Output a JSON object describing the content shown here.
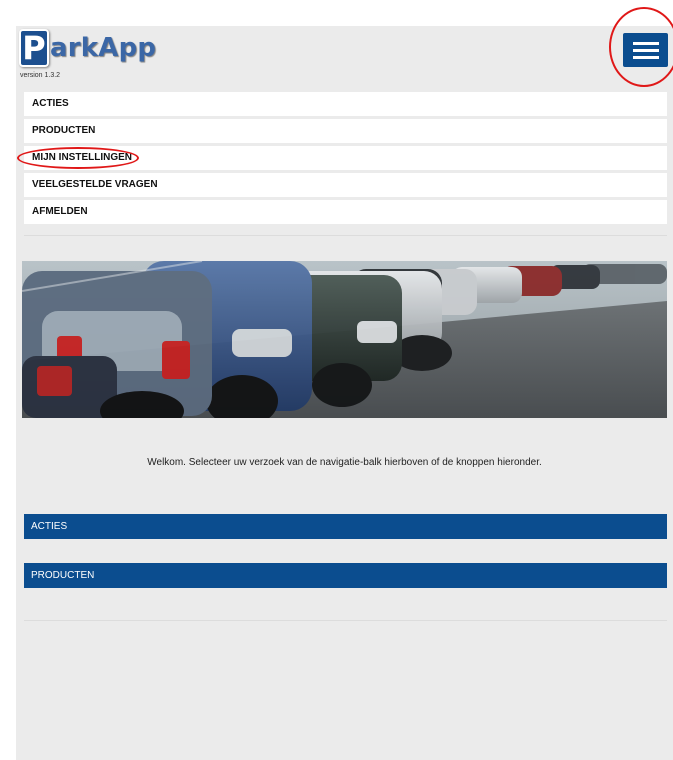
{
  "header": {
    "logo_letter": "P",
    "logo_text": "arkApp",
    "version": "version 1.3.2",
    "menu_icon": "hamburger-menu-icon"
  },
  "nav": {
    "items": [
      {
        "label": "ACTIES"
      },
      {
        "label": "PRODUCTEN"
      },
      {
        "label": "MIJN INSTELLINGEN"
      },
      {
        "label": "VEELGESTELDE VRAGEN"
      },
      {
        "label": "AFMELDEN"
      }
    ]
  },
  "main": {
    "banner_alt": "parked cars banner",
    "welcome": "Welkom. Selecteer uw verzoek van de navigatie-balk hierboven of de knoppen hieronder.",
    "buttons": [
      {
        "label": "ACTIES"
      },
      {
        "label": "PRODUCTEN"
      }
    ]
  },
  "colors": {
    "brand_blue": "#0b4d8f",
    "page_background": "#ebebeb",
    "highlight_circle": "#e01818"
  }
}
